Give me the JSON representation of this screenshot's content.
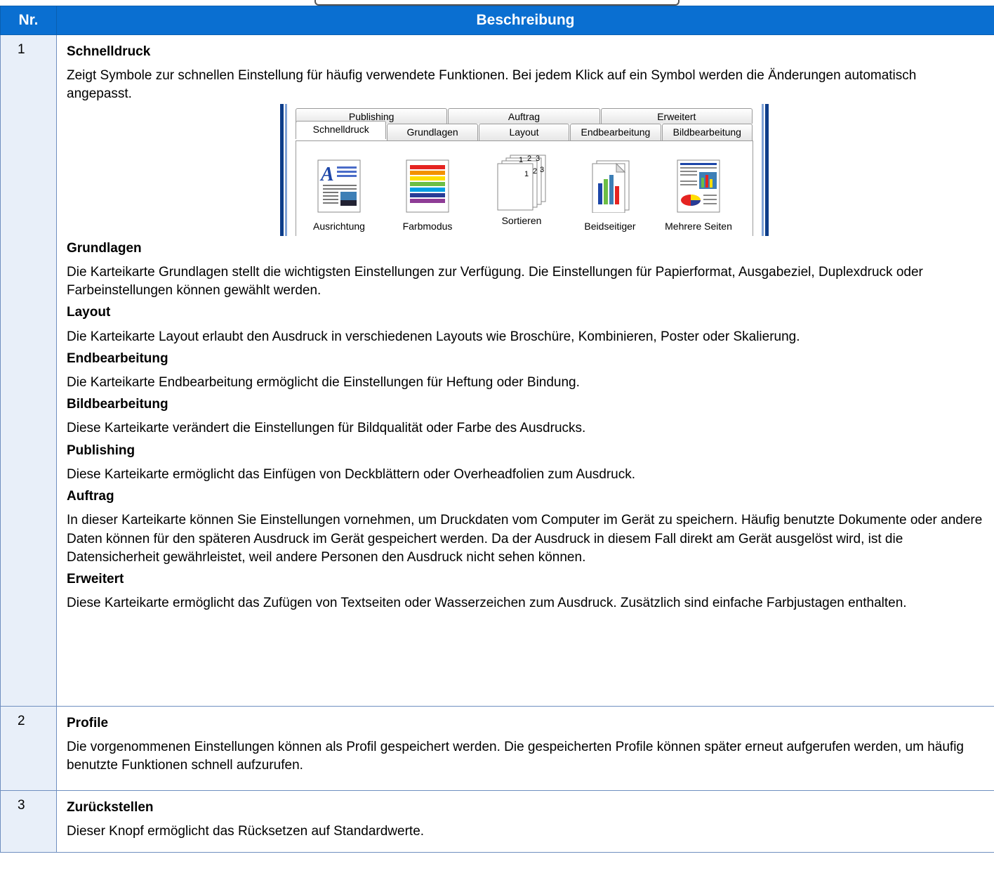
{
  "header": {
    "col_nr": "Nr.",
    "col_desc": "Beschreibung"
  },
  "rows": [
    {
      "nr": "1",
      "sections": [
        {
          "title": "Schnelldruck",
          "text": "Zeigt Symbole zur schnellen Einstellung für häufig verwendete Funktionen. Bei jedem Klick auf ein Symbol werden die Änderungen automatisch angepasst."
        },
        {
          "title": "Grundlagen",
          "text": "Die Karteikarte Grundlagen stellt die wichtigsten Einstellungen zur Verfügung. Die Einstellungen für Papierformat, Ausgabeziel, Duplexdruck oder Farbeinstellungen können gewählt werden."
        },
        {
          "title": "Layout",
          "text": "Die Karteikarte Layout erlaubt den Ausdruck in verschiedenen Layouts wie Broschüre, Kombinieren, Poster oder Skalierung."
        },
        {
          "title": "Endbearbeitung",
          "text": "Die Karteikarte Endbearbeitung ermöglicht die Einstellungen für Heftung oder Bindung."
        },
        {
          "title": "Bildbearbeitung",
          "text": "Diese Karteikarte verändert die Einstellungen für Bildqualität oder Farbe des Ausdrucks."
        },
        {
          "title": "Publishing",
          "text": "Diese Karteikarte ermöglicht das Einfügen von Deckblättern oder Overheadfolien zum Ausdruck."
        },
        {
          "title": "Auftrag",
          "text": "In dieser Karteikarte können Sie Einstellungen vornehmen, um Druckdaten vom Computer im Gerät zu speichern. Häufig benutzte Dokumente oder andere Daten können für den späteren Ausdruck im Gerät gespeichert werden. Da der Ausdruck in diesem Fall direkt am Gerät ausgelöst wird, ist die Datensicherheit gewährleistet, weil andere Personen den Ausdruck nicht sehen können."
        },
        {
          "title": "Erweitert",
          "text": "Diese Karteikarte ermöglicht das Zufügen von Textseiten oder Wasserzeichen zum Ausdruck. Zusätzlich sind einfache Farbjustagen enthalten."
        }
      ]
    },
    {
      "nr": "2",
      "sections": [
        {
          "title": "Profile",
          "text": "Die vorgenommenen Einstellungen können als Profil gespeichert werden. Die gespeicherten Profile können später erneut aufgerufen werden, um häufig benutzte Funktionen schnell aufzurufen."
        }
      ]
    },
    {
      "nr": "3",
      "sections": [
        {
          "title": "Zurückstellen",
          "text": "Dieser Knopf ermöglicht das Rücksetzen auf Standardwerte."
        }
      ]
    }
  ],
  "screenshot": {
    "tabs_row1": [
      "Publishing",
      "Auftrag",
      "Erweitert"
    ],
    "tabs_row2": [
      "Schnelldruck",
      "Grundlagen",
      "Layout",
      "Endbearbeitung",
      "Bildbearbeitung"
    ],
    "active_tab": "Schnelldruck",
    "icons": [
      {
        "label": "Ausrichtung",
        "icon": "orientation-icon"
      },
      {
        "label": "Farbmodus",
        "icon": "color-mode-icon"
      },
      {
        "label": "Sortieren",
        "icon": "collate-icon",
        "glyph": "1 2 3"
      },
      {
        "label": "Beidseitiger",
        "icon": "duplex-icon"
      },
      {
        "label": "Mehrere Seiten",
        "icon": "multiple-pages-icon"
      }
    ],
    "colors": {
      "header_bg": "#0a6fd1",
      "nr_bg": "#e8eff9",
      "border": "#6f8fc0"
    }
  }
}
